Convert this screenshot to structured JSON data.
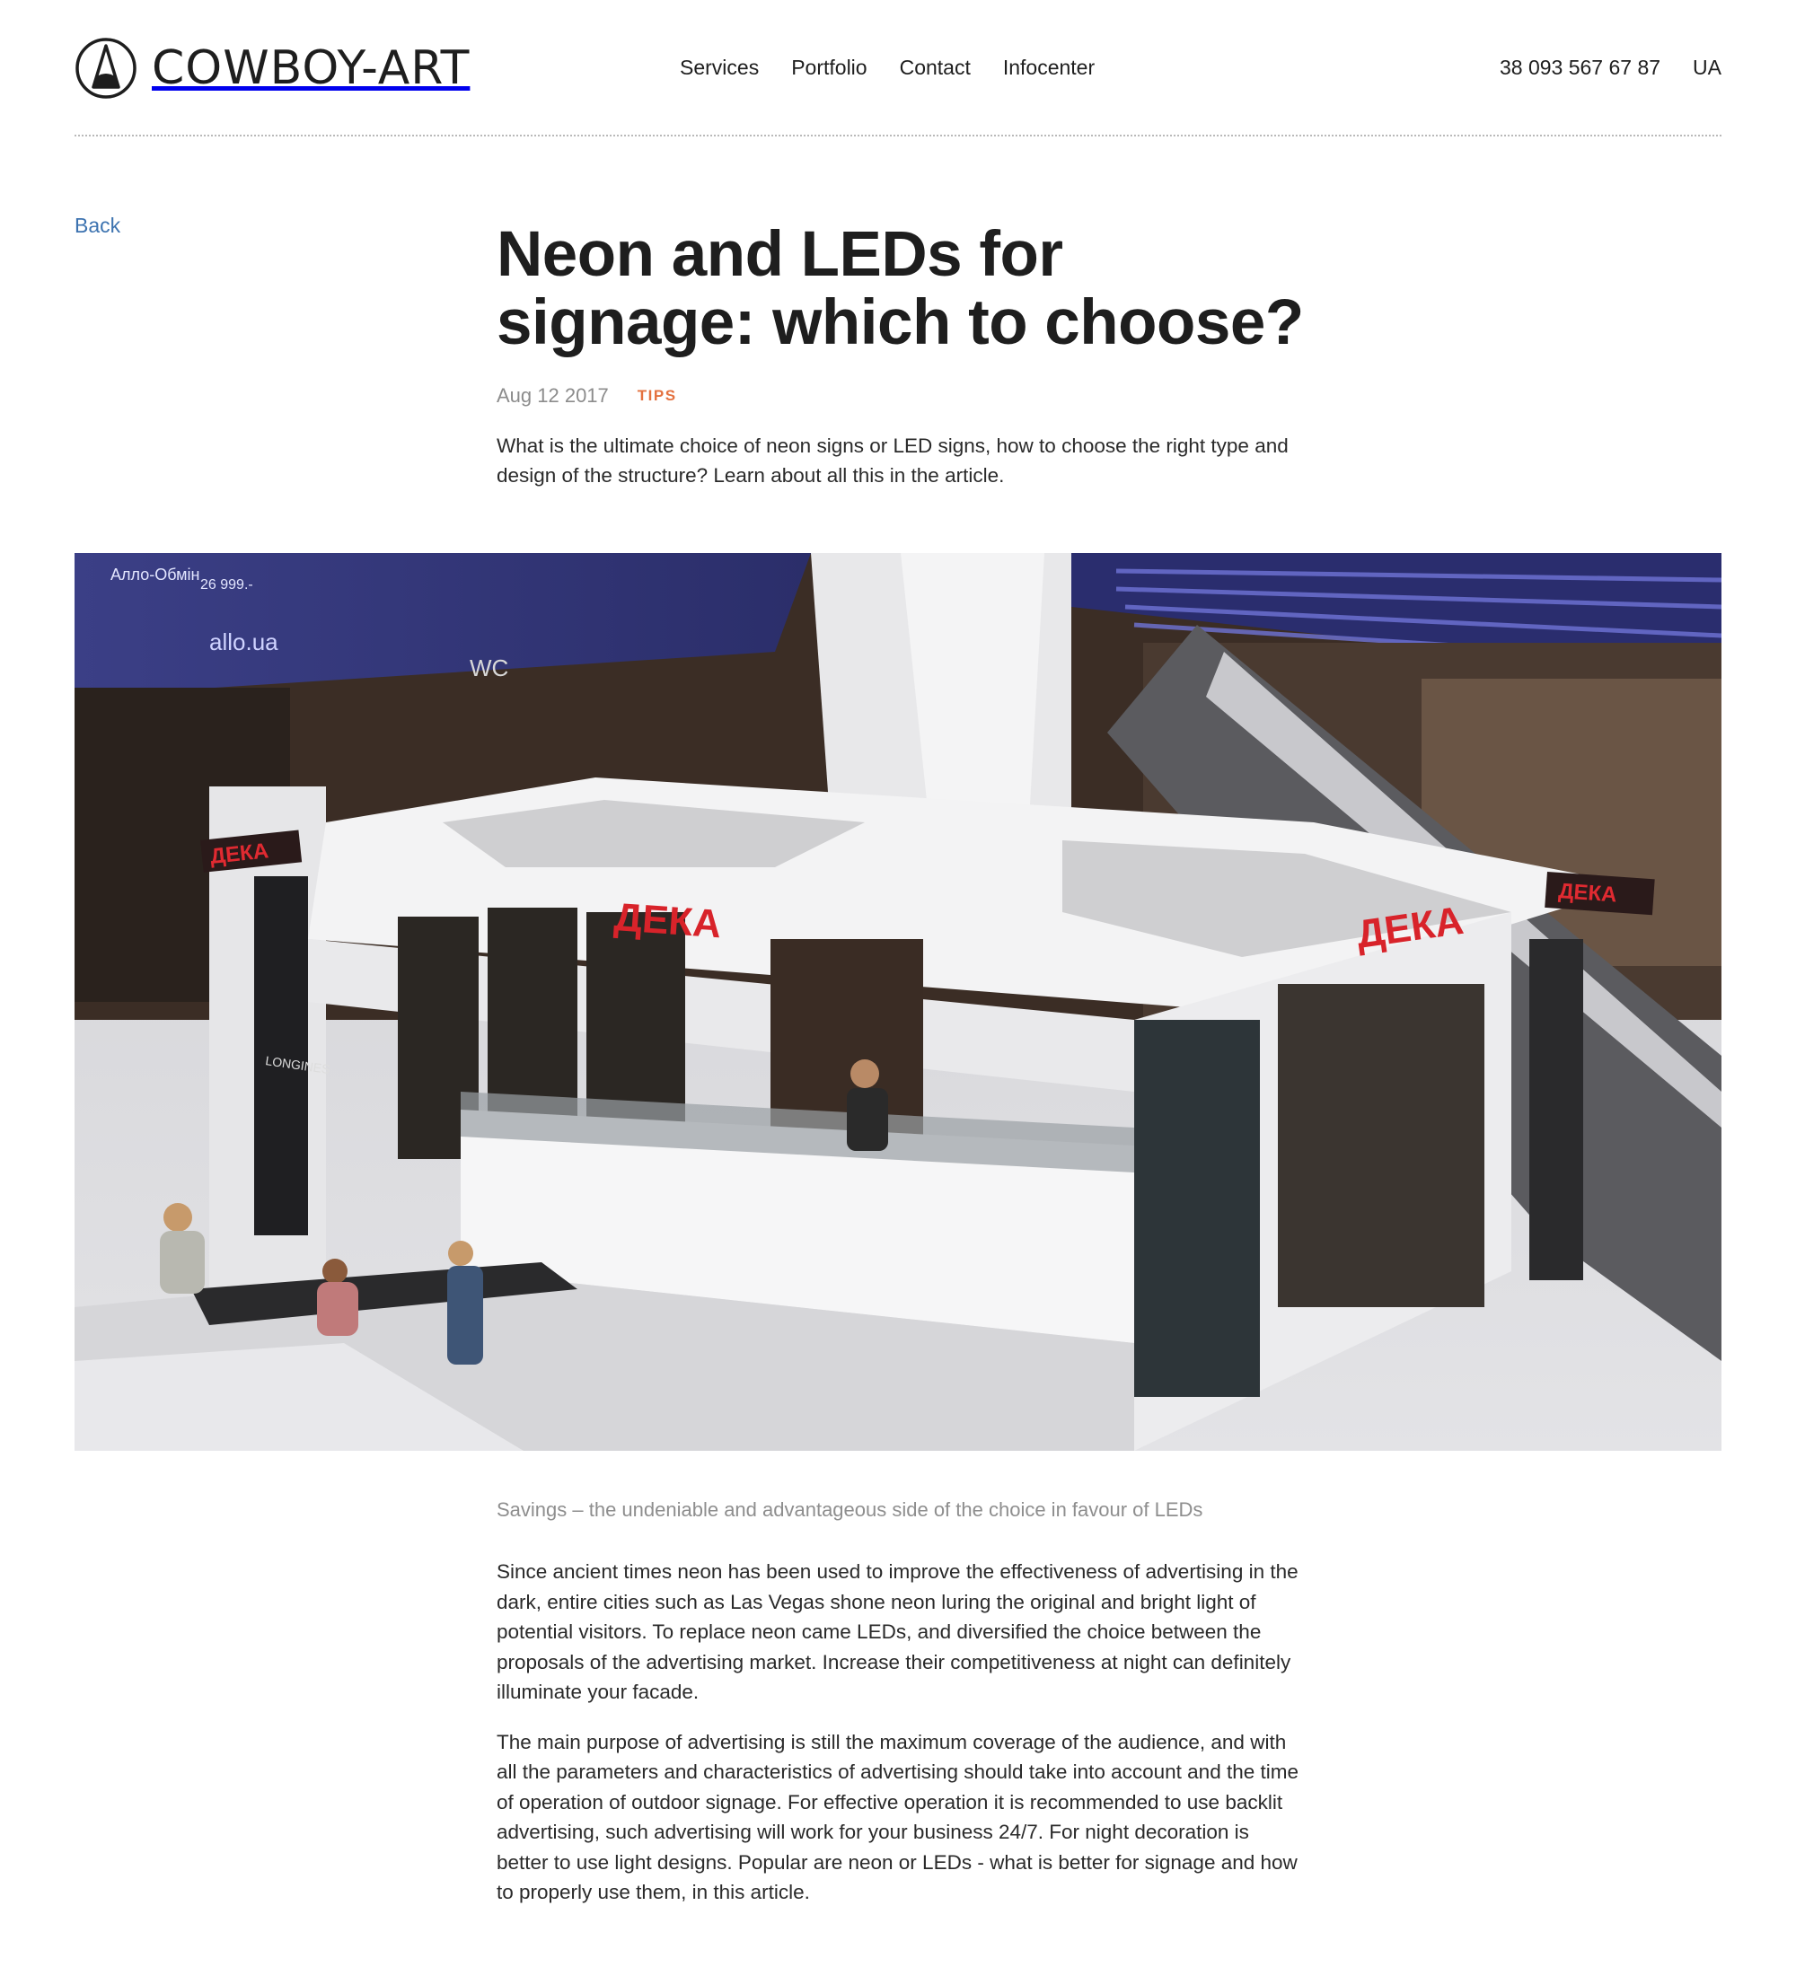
{
  "header": {
    "logo_text": "COWBOY-ART",
    "nav": [
      "Services",
      "Portfolio",
      "Contact",
      "Infocenter"
    ],
    "phone": "38 093 567 67 87",
    "language": "UA"
  },
  "back_label": "Back",
  "article": {
    "title_line1": "Neon and LEDs for",
    "title_line2": "signage: which to choose?",
    "date": "Aug 12 2017",
    "tag": "TIPS",
    "lead": "What is the ultimate choice of neon signs or LED signs, how to choose the right type and design of the structure? Learn about all this in the article.",
    "caption": "Savings – the undeniable and advantageous side of the choice in favour of LEDs",
    "paragraphs": [
      "Since ancient times neon has been used to improve the effectiveness of advertising in the dark, entire cities such as Las Vegas shone neon luring the original and bright light of potential visitors. To replace neon came LEDs, and diversified the choice between the proposals of the advertising market. Increase their competitiveness at night can definitely illuminate your facade.",
      "The main purpose of advertising is still the maximum coverage of the audience, and with all the parameters and characteristics of advertising should take into account and the time of operation of outdoor signage. For effective operation it is recommended to use backlit advertising, such advertising will work for your business 24/7. For night decoration is better to use light designs. Popular are neon or LEDs - what is better for signage and how to properly use them, in this article."
    ]
  },
  "photo": {
    "sign_text": "ДЕКА",
    "screen_text_1": "allo.ua",
    "screen_text_2": "Алло-Обмін",
    "screen_text_3": "26 999.-",
    "wc_label": "WC",
    "poster_label": "LONGINES",
    "sign_color": "#d8232a"
  },
  "colors": {
    "accent_link": "#3d73b0",
    "tag": "#e4713f"
  }
}
